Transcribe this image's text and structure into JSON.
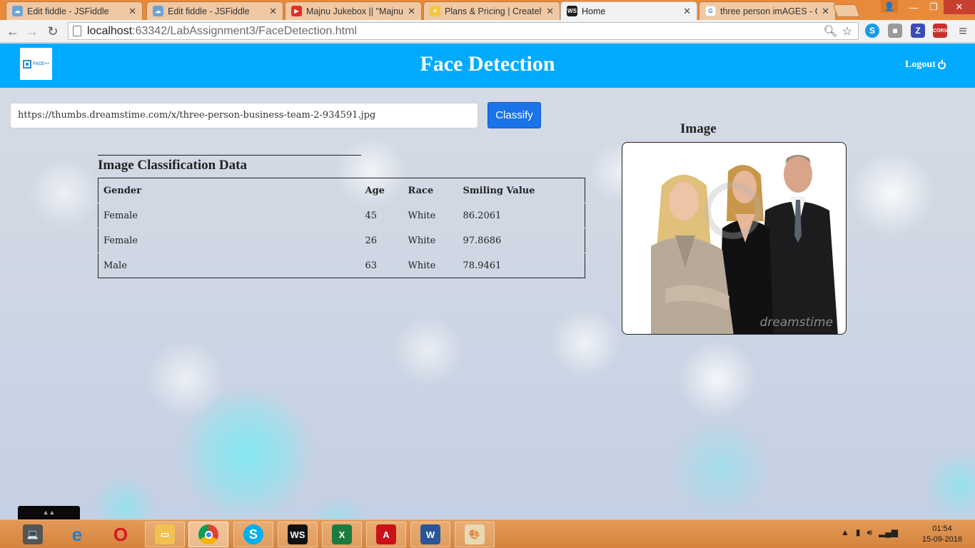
{
  "browser": {
    "tabs": [
      {
        "label": "Edit fiddle - JSFiddle",
        "icon": "jsfiddle-cloud-icon"
      },
      {
        "label": "Edit fiddle - JSFiddle",
        "icon": "jsfiddle-cloud-icon"
      },
      {
        "label": "Majnu Jukebox || \"Majnu\"",
        "icon": "youtube-icon"
      },
      {
        "label": "Plans & Pricing | Creately",
        "icon": "creately-bulb-icon"
      },
      {
        "label": "Home",
        "icon": "webstorm-icon"
      },
      {
        "label": "three person imAGES - Go",
        "icon": "google-g-icon"
      }
    ],
    "address": {
      "host": "localhost",
      "path": ":63342/LabAssignment3/FaceDetection.html"
    },
    "extensions": [
      "skype-extension-icon",
      "grey-extension-icon",
      "z-extension-icon",
      "cors-extension-icon"
    ]
  },
  "page": {
    "logo_text": "FACE++",
    "title": "Face Detection",
    "logout_label": "Logout",
    "url_value": "https://thumbs.dreamstime.com/x/three-person-business-team-2-934591.jpg",
    "classify_label": "Classify",
    "panel_title": "Image Classification Data",
    "table": {
      "headers": [
        "Gender",
        "Age",
        "Race",
        "Smiling Value"
      ],
      "rows": [
        [
          "Female",
          "45",
          "White",
          "86.2061"
        ],
        [
          "Female",
          "26",
          "White",
          "97.8686"
        ],
        [
          "Male",
          "63",
          "White",
          "78.9461"
        ]
      ]
    },
    "image_title": "Image",
    "watermark": "dreamstime"
  },
  "taskbar": {
    "apps": [
      "laptop-settings-icon",
      "internet-explorer-icon",
      "opera-icon",
      "file-explorer-icon",
      "chrome-icon",
      "skype-icon",
      "webstorm-icon",
      "excel-icon",
      "acrobat-icon",
      "word-icon",
      "paint-icon"
    ],
    "clock_time": "01:54",
    "clock_date": "15-09-2016"
  },
  "colors": {
    "navbar": "#00aaff",
    "classify_button": "#1a73e8",
    "taskbar": "#d5843d"
  }
}
